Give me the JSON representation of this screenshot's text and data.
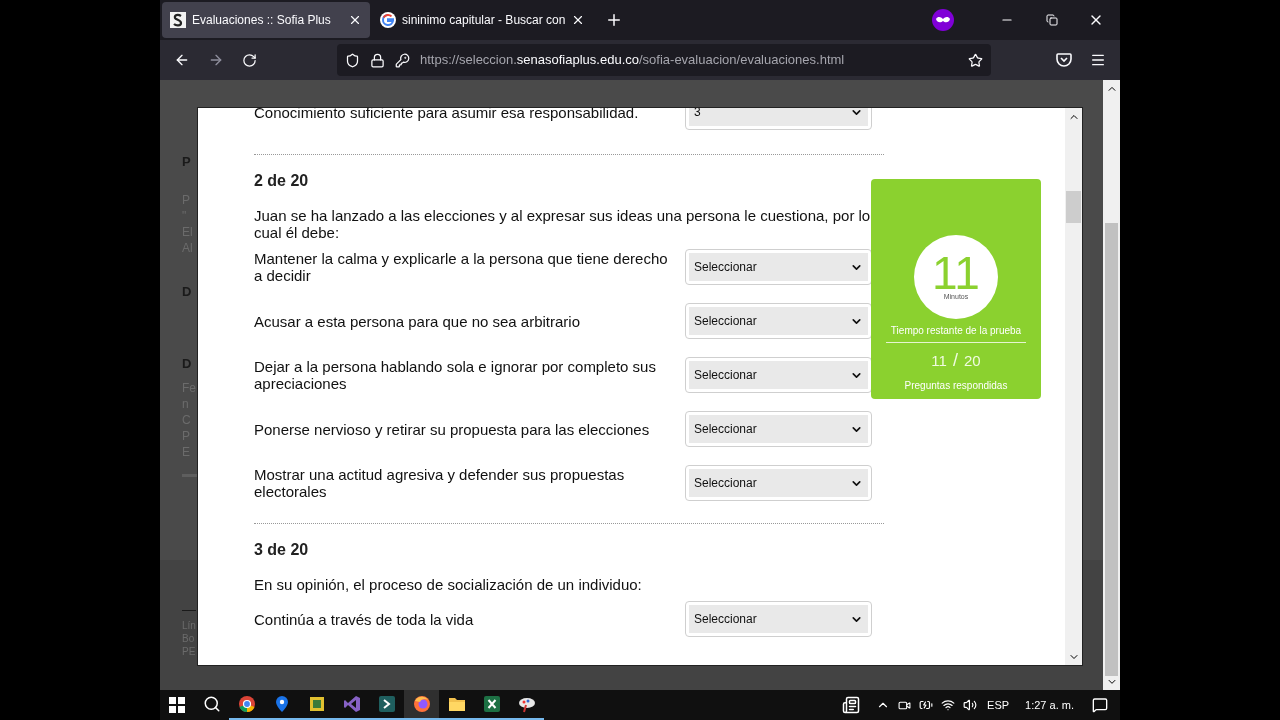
{
  "browser": {
    "tabs": [
      {
        "title": "Evaluaciones :: Sofia Plus",
        "selected": true
      },
      {
        "title": "sininimo capitular - Buscar con",
        "selected": false
      }
    ],
    "url": {
      "prefix": "https://seleccion.",
      "domain": "senasofiaplus.edu.co",
      "path": "/sofia-evaluacion/evaluaciones.html"
    }
  },
  "background_page": {
    "fragments": [
      {
        "text": "P",
        "bold": true
      },
      {
        "text": "P",
        "bold": false
      },
      {
        "text": "\"",
        "bold": false
      },
      {
        "text": "El",
        "bold": false
      },
      {
        "text": "Al",
        "bold": false
      },
      {
        "text": "D",
        "bold": true
      },
      {
        "text": "D",
        "bold": true
      },
      {
        "text": "Fe",
        "bold": false
      },
      {
        "text": "n",
        "bold": false
      },
      {
        "text": "C",
        "bold": false
      },
      {
        "text": "P",
        "bold": false
      },
      {
        "text": "E",
        "bold": false
      }
    ],
    "footer": [
      "Lín",
      "Bo",
      "PE"
    ]
  },
  "previous_option": {
    "text": "Conocimiento suficiente para asumir esa responsabilidad.",
    "value": "3"
  },
  "questions": [
    {
      "number": "2 de 20",
      "prompt": "Juan se ha lanzado a las elecciones y al expresar sus ideas una persona le cuestiona, por lo cual él debe:",
      "options": [
        {
          "text": "Mantener la calma y explicarle a la persona que tiene derecho a decidir",
          "value": "Seleccionar"
        },
        {
          "text": "Acusar a esta persona para que no sea arbitrario",
          "value": "Seleccionar"
        },
        {
          "text": "Dejar a la persona hablando sola e ignorar por completo sus apreciaciones",
          "value": "Seleccionar"
        },
        {
          "text": "Ponerse nervioso y retirar su propuesta para las elecciones",
          "value": "Seleccionar"
        },
        {
          "text": "Mostrar una actitud agresiva y defender sus propuestas electorales",
          "value": "Seleccionar"
        }
      ]
    },
    {
      "number": "3 de 20",
      "prompt": "En su opinión, el proceso de socialización de un individuo:",
      "options": [
        {
          "text": "Continúa a través de toda la vida",
          "value": "Seleccionar"
        }
      ]
    }
  ],
  "timer": {
    "minutes": "11",
    "unit": "Minutos",
    "caption": "Tiempo restante de la prueba",
    "answered": "11",
    "separator": "/",
    "total": "20",
    "answered_caption": "Preguntas respondidas"
  },
  "taskbar": {
    "apps": [
      {
        "kind": "search",
        "running": false
      },
      {
        "kind": "chrome",
        "running": true
      },
      {
        "kind": "maps",
        "running": true
      },
      {
        "kind": "tool",
        "running": true
      },
      {
        "kind": "vs",
        "running": true
      },
      {
        "kind": "terminal",
        "running": true
      },
      {
        "kind": "firefox",
        "running": true
      },
      {
        "kind": "folder",
        "running": true
      },
      {
        "kind": "excel",
        "running": true
      },
      {
        "kind": "paint",
        "running": true
      }
    ],
    "language": "ESP",
    "time": "1:27 a. m."
  }
}
